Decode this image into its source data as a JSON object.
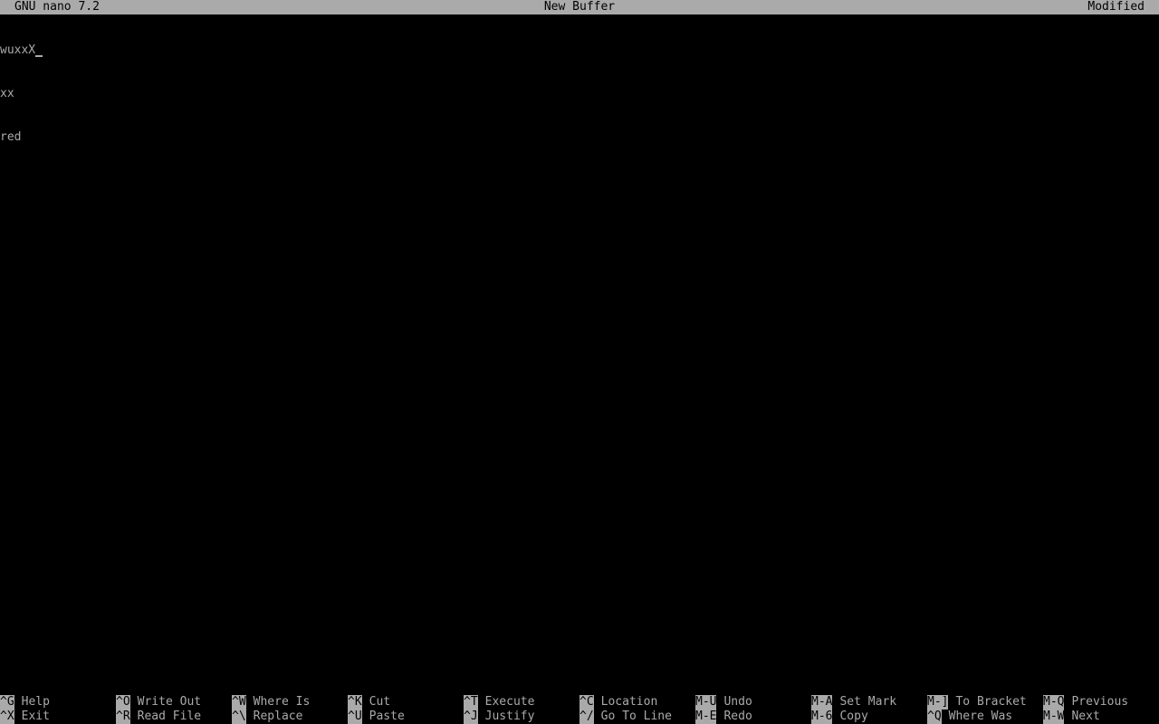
{
  "titlebar": {
    "version": "GNU nano 7.2",
    "buffer": "New Buffer",
    "status": "Modified"
  },
  "editor": {
    "lines": [
      "wuxxX",
      "xx",
      "red"
    ]
  },
  "shortcuts": {
    "row1": [
      {
        "key": "^G",
        "label": "Help"
      },
      {
        "key": "^O",
        "label": "Write Out"
      },
      {
        "key": "^W",
        "label": "Where Is"
      },
      {
        "key": "^K",
        "label": "Cut"
      },
      {
        "key": "^T",
        "label": "Execute"
      },
      {
        "key": "^C",
        "label": "Location"
      },
      {
        "key": "M-U",
        "label": "Undo"
      },
      {
        "key": "M-A",
        "label": "Set Mark"
      },
      {
        "key": "M-]",
        "label": "To Bracket"
      },
      {
        "key": "M-Q",
        "label": "Previous"
      }
    ],
    "row2": [
      {
        "key": "^X",
        "label": "Exit"
      },
      {
        "key": "^R",
        "label": "Read File"
      },
      {
        "key": "^\\",
        "label": "Replace"
      },
      {
        "key": "^U",
        "label": "Paste"
      },
      {
        "key": "^J",
        "label": "Justify"
      },
      {
        "key": "^/",
        "label": "Go To Line"
      },
      {
        "key": "M-E",
        "label": "Redo"
      },
      {
        "key": "M-6",
        "label": "Copy"
      },
      {
        "key": "^Q",
        "label": "Where Was"
      },
      {
        "key": "M-W",
        "label": "Next"
      }
    ]
  },
  "colors": {
    "background": "#000000",
    "foreground": "#aaaaaa",
    "inverse_background": "#aaaaaa",
    "inverse_foreground": "#000000"
  }
}
